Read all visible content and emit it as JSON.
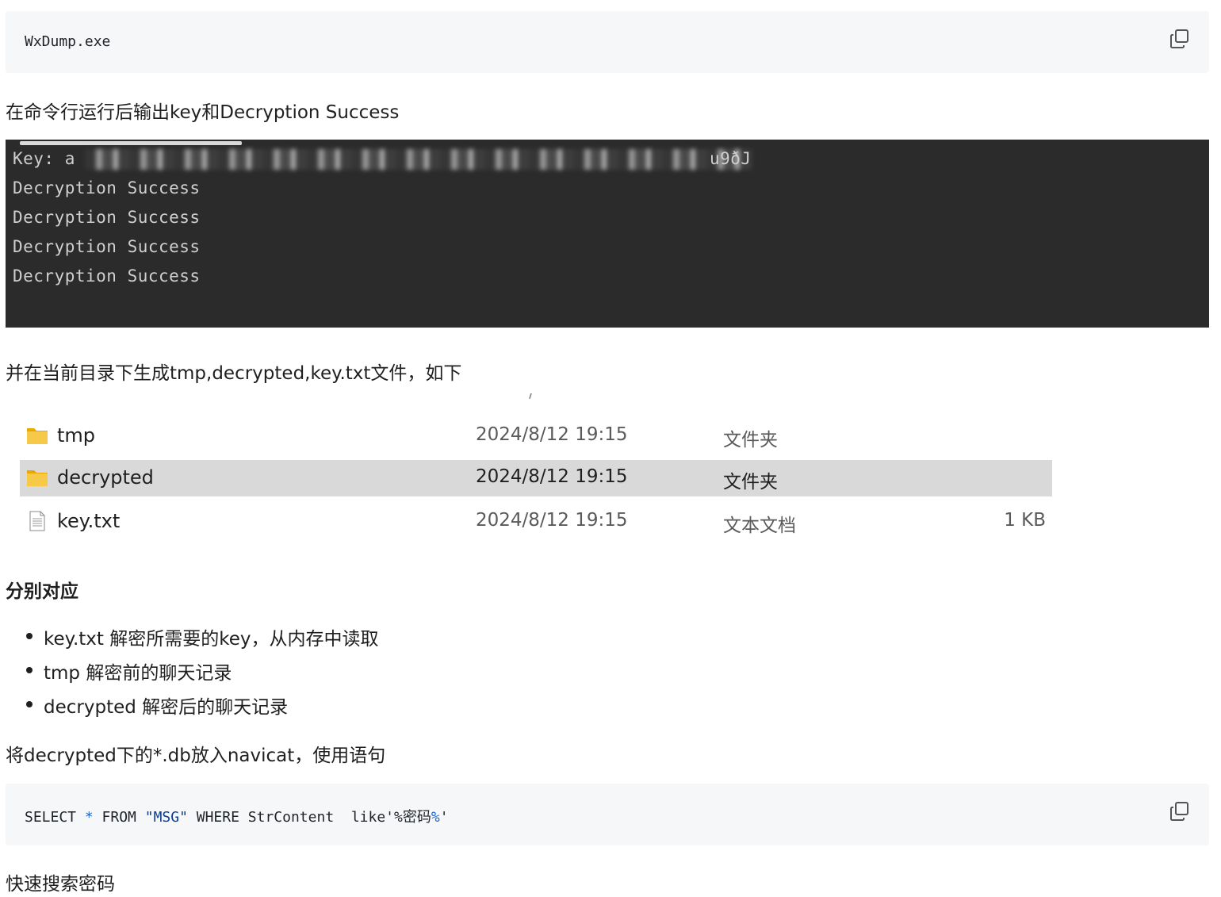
{
  "code_block_1": {
    "code": "WxDump.exe"
  },
  "para_1": "在命令行运行后输出key和Decryption Success",
  "terminal": {
    "key_label": "Key: a",
    "key_tail": "u9ðJ",
    "lines": [
      "Decryption Success",
      "Decryption Success",
      "Decryption Success",
      "Decryption Success"
    ]
  },
  "para_2": "并在当前目录下生成tmp,decrypted,key.txt文件，如下",
  "file_list": {
    "rows": [
      {
        "name": "tmp",
        "date": "2024/8/12 19:15",
        "type": "文件夹",
        "size": "",
        "icon": "folder-icon"
      },
      {
        "name": "decrypted",
        "date": "2024/8/12 19:15",
        "type": "文件夹",
        "size": "",
        "icon": "folder-icon",
        "selected": true
      },
      {
        "name": "key.txt",
        "date": "2024/8/12 19:15",
        "type": "文本文档",
        "size": "1 KB",
        "icon": "text-file-icon"
      }
    ]
  },
  "heading_1": "分别对应",
  "bullets": [
    "key.txt 解密所需要的key，从内存中读取",
    "tmp 解密前的聊天记录",
    "decrypted 解密后的聊天记录"
  ],
  "para_3": "将decrypted下的*.db放入navicat，使用语句",
  "code_block_2": {
    "tokens": [
      {
        "text": "SELECT ",
        "kind": "plain"
      },
      {
        "text": "*",
        "kind": "op"
      },
      {
        "text": " FROM ",
        "kind": "plain"
      },
      {
        "text": "\"MSG\"",
        "kind": "str"
      },
      {
        "text": " WHERE StrContent  like'%密码",
        "kind": "plain"
      },
      {
        "text": "%",
        "kind": "op"
      },
      {
        "text": "'",
        "kind": "plain"
      }
    ]
  },
  "para_4": "快速搜索密码",
  "colors": {
    "terminal_bg": "#2b2b2b",
    "code_bg": "#f6f7f9",
    "selected_row": "#d9d9d9",
    "folder": "#f4c430"
  }
}
